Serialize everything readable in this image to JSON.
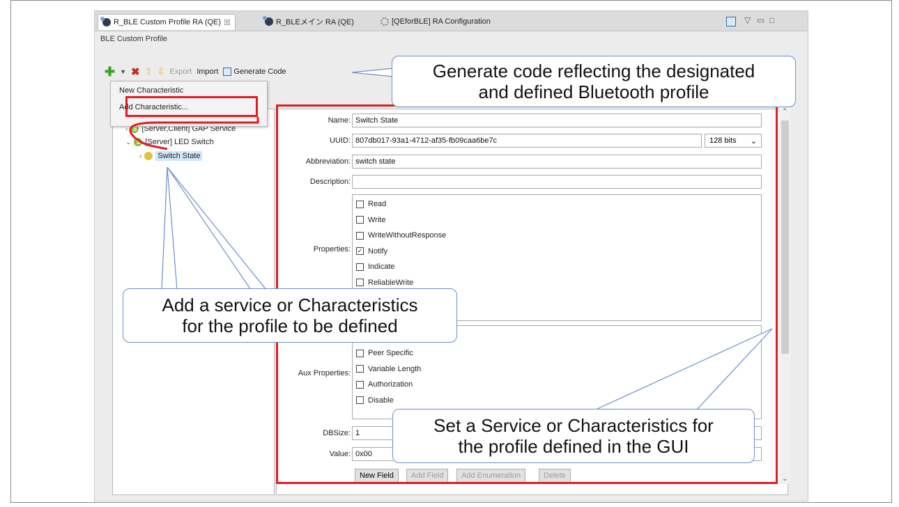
{
  "tabs": [
    {
      "label": "R_BLE Custom Profile RA (QE)",
      "close": "☒"
    },
    {
      "label": "R_BLEメイン RA (QE)"
    },
    {
      "label": "[QEforBLE] RA Configuration"
    }
  ],
  "section_title": "BLE Custom Profile",
  "toolbar": {
    "export": "Export",
    "import": "Import",
    "generate": "Generate Code"
  },
  "menu": {
    "new": "New Characteristic",
    "add": "Add Characteristic..."
  },
  "tree": {
    "gap_service": "[Server,Client] GAP Service",
    "led_switch": "[Server] LED Switch",
    "switch_state": "Switch State",
    "service_icon_letter": "S"
  },
  "form": {
    "name_label": "Name:",
    "name_value": "Switch State",
    "uuid_label": "UUID:",
    "uuid_value": "807db017-93a1-4712-af35-fb09caa6be7c",
    "uuid_bits": "128 bits",
    "abbr_label": "Abbreviation:",
    "abbr_value": "switch state",
    "desc_label": "Description:",
    "desc_value": "",
    "props_label": "Properties:",
    "props": [
      {
        "label": "Read",
        "checked": false
      },
      {
        "label": "Write",
        "checked": false
      },
      {
        "label": "WriteWithoutResponse",
        "checked": false
      },
      {
        "label": "Notify",
        "checked": true
      },
      {
        "label": "Indicate",
        "checked": false
      },
      {
        "label": "ReliableWrite",
        "checked": false
      }
    ],
    "aux_label": "Aux Properties:",
    "aux": [
      {
        "label": "Peer Specific",
        "checked": false
      },
      {
        "label": "Variable Length",
        "checked": false
      },
      {
        "label": "Authorization",
        "checked": false
      },
      {
        "label": "Disable",
        "checked": false
      }
    ],
    "dbsize_label": "DBSize:",
    "dbsize_value": "1",
    "value_label": "Value:",
    "value_value": "0x00",
    "buttons": {
      "new_field": "New Field",
      "add_field": "Add Field",
      "add_enum": "Add Enumeration",
      "delete": "Delete"
    }
  },
  "callouts": {
    "generate": [
      "Generate code reflecting the designated",
      "and defined Bluetooth profile"
    ],
    "add": [
      "Add a service or Characteristics",
      "for the profile to  be defined"
    ],
    "set": [
      "Set a Service or Characteristics for",
      "the profile defined in the GUI"
    ]
  },
  "colors": {
    "highlight": "#e31b23",
    "callout_border": "#6a8ec8",
    "selection": "#cfe6fb"
  }
}
